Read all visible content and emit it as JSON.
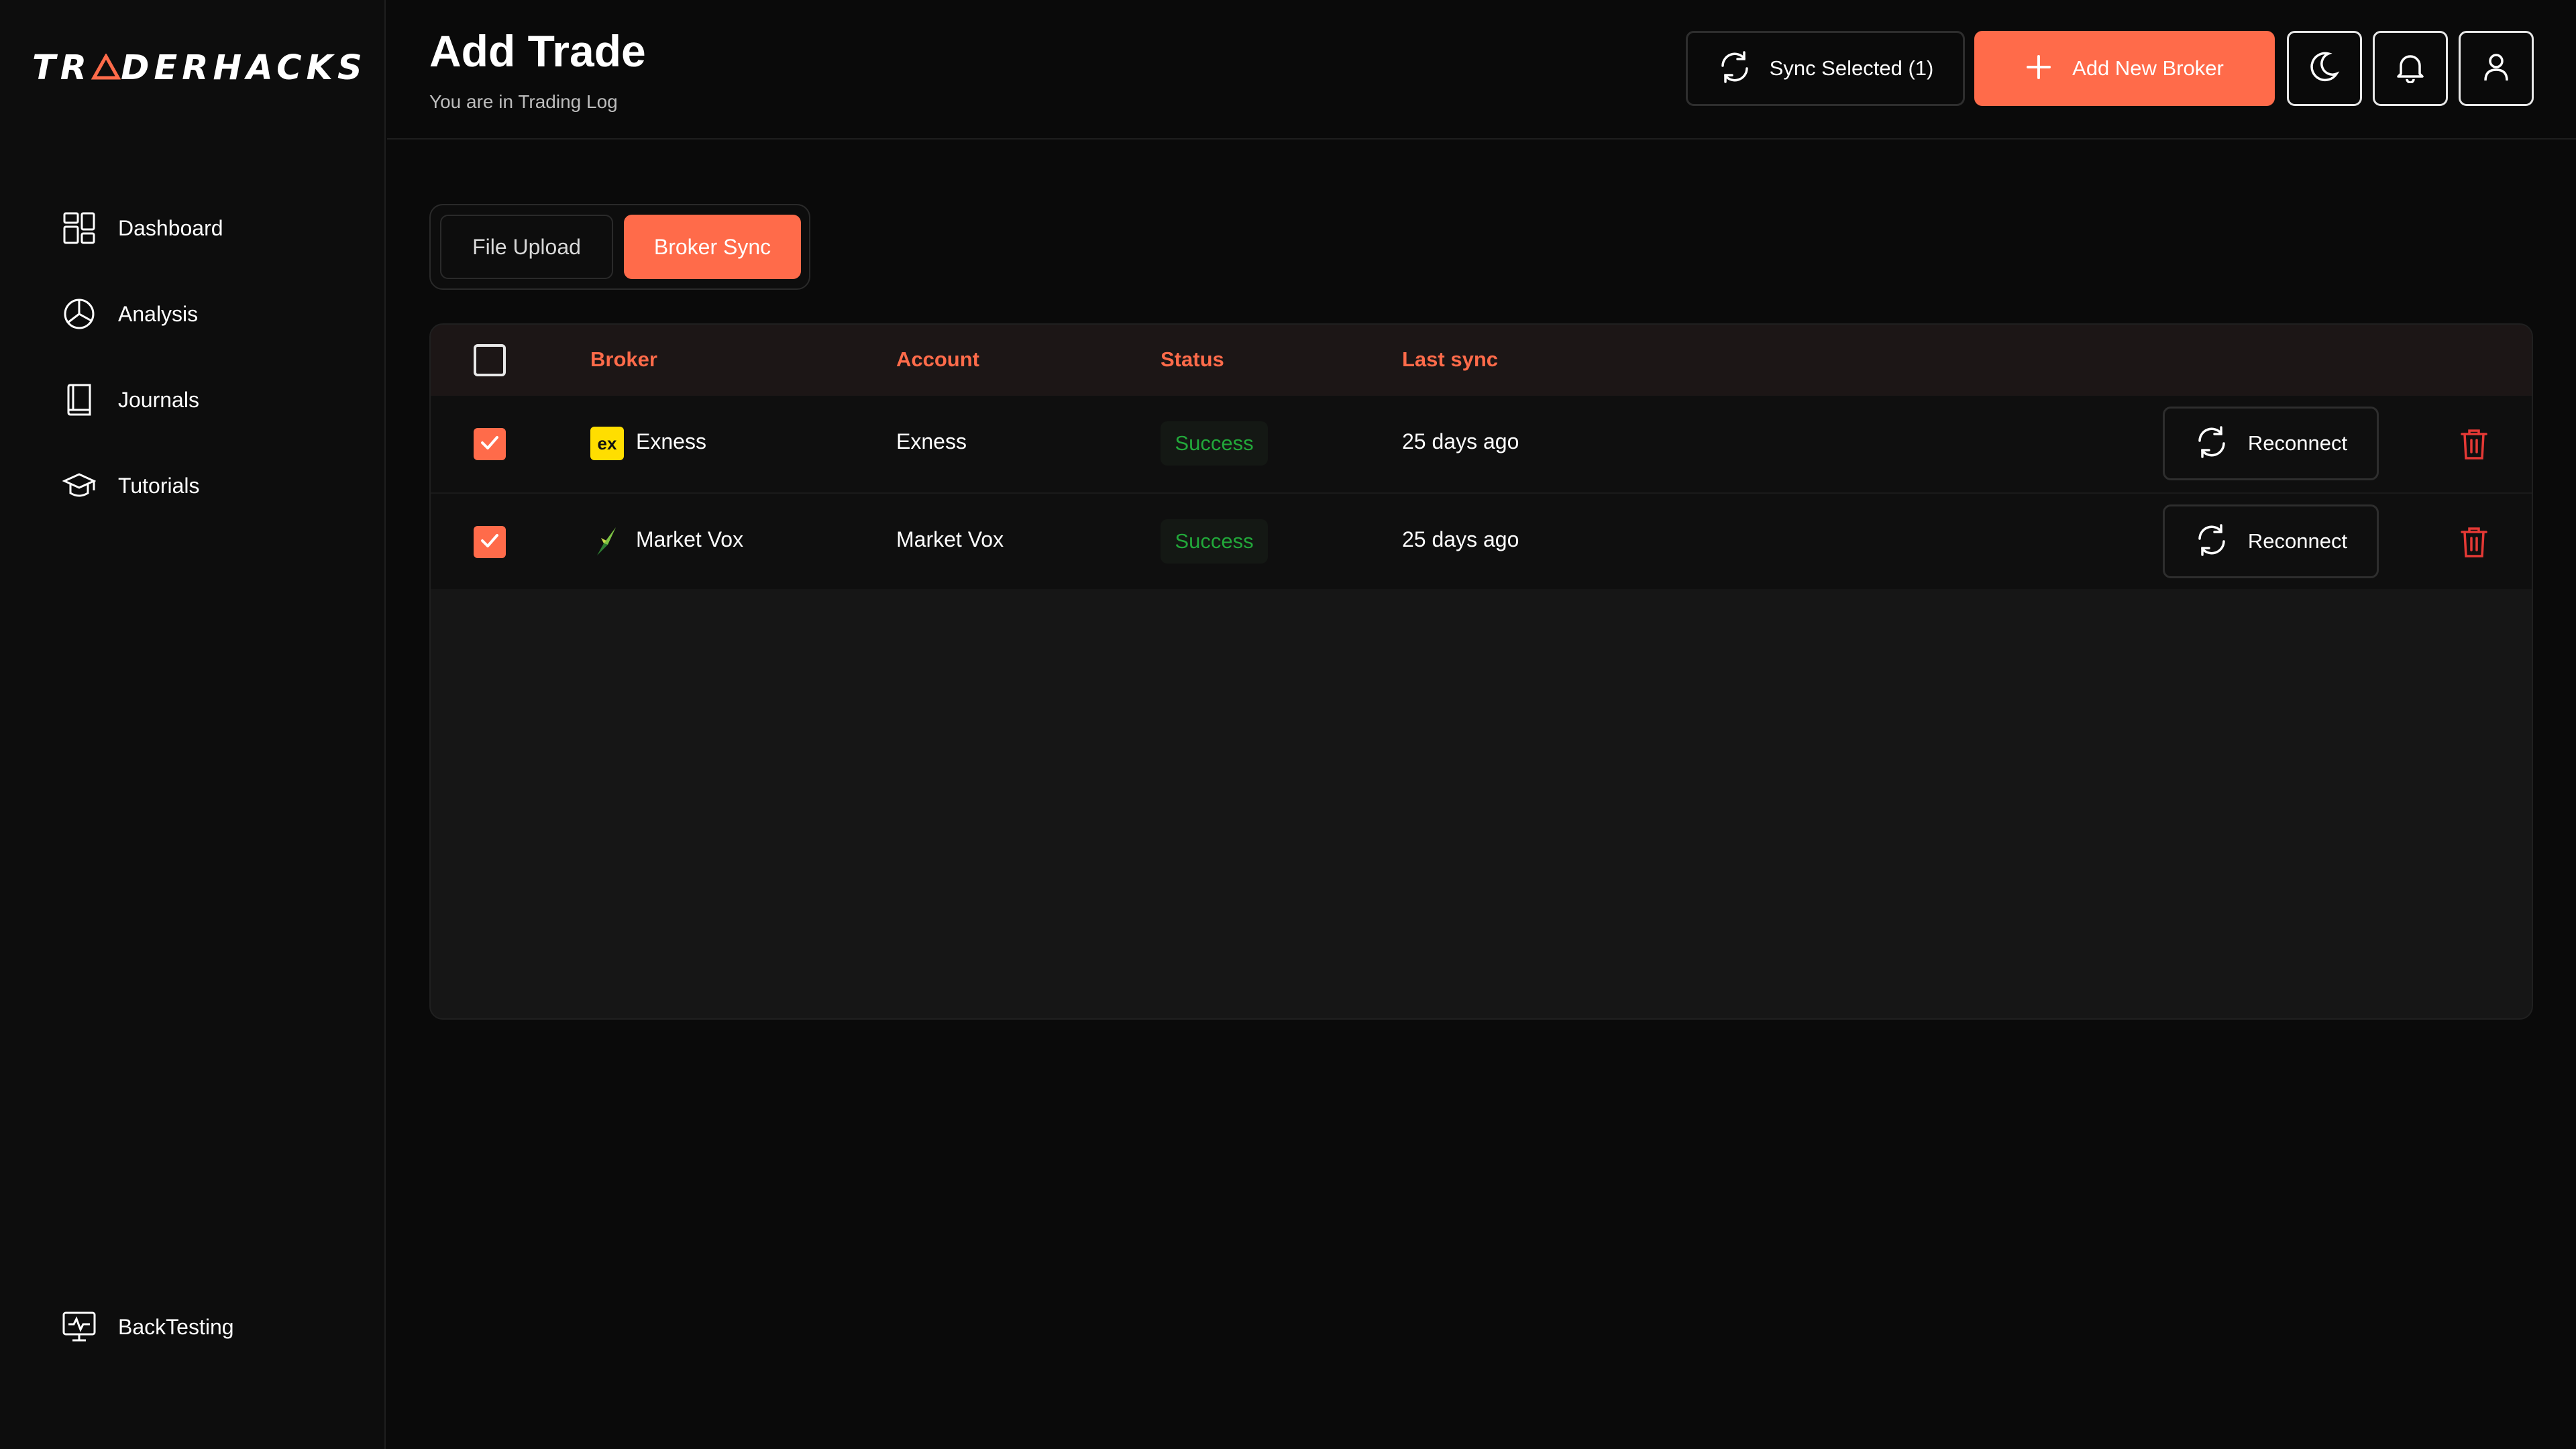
{
  "app": {
    "logo_text_a": "TR",
    "logo_text_b": "DERHACKS",
    "accent_color": "#ff6b4a"
  },
  "sidebar": {
    "items": [
      {
        "label": "Dashboard",
        "icon": "dashboard-icon"
      },
      {
        "label": "Analysis",
        "icon": "pie-chart-icon"
      },
      {
        "label": "Journals",
        "icon": "book-icon"
      },
      {
        "label": "Tutorials",
        "icon": "graduation-cap-icon"
      }
    ],
    "bottom_item": {
      "label": "BackTesting",
      "icon": "monitor-pulse-icon"
    }
  },
  "header": {
    "title": "Add Trade",
    "subtitle": "You are in Trading Log",
    "sync_label": "Sync Selected (1)",
    "add_broker_label": "Add New Broker"
  },
  "tabs": [
    {
      "label": "File Upload",
      "active": false
    },
    {
      "label": "Broker Sync",
      "active": true
    }
  ],
  "table": {
    "columns": [
      "Broker",
      "Account",
      "Status",
      "Last sync"
    ],
    "rows": [
      {
        "broker": "Exness",
        "logo_text": "ex",
        "account": "Exness",
        "status": "Success",
        "last_sync": "25 days ago",
        "action": "Reconnect",
        "checked": true
      },
      {
        "broker": "Market Vox",
        "account": "Market Vox",
        "status": "Success",
        "last_sync": "25 days ago",
        "action": "Reconnect",
        "checked": true
      }
    ]
  }
}
